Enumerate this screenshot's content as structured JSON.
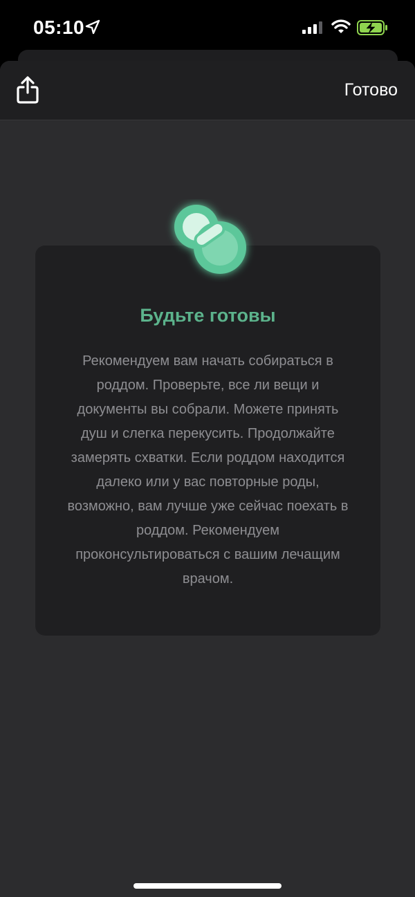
{
  "status_bar": {
    "time": "05:10",
    "icons": [
      "location-arrow-icon",
      "cellular-signal-icon",
      "wifi-icon",
      "battery-charging-icon"
    ]
  },
  "nav": {
    "share_icon": "share-icon",
    "done_label": "Готово"
  },
  "card": {
    "icon": "pacifier-icon",
    "title": "Будьте готовы",
    "body": "Рекомендуем вам начать собираться в роддом. Проверьте, все ли вещи и документы вы собрали. Можете принять душ и слегка перекусить. Продолжайте замерять схватки. Если роддом находится далеко или у вас повторные роды, возможно, вам лучше уже сейчас поехать в роддом. Рекомендуем проконсультироваться с вашим лечащим врачом."
  },
  "colors": {
    "accent": "#5cb38c",
    "background": "#2c2c2e",
    "card": "#1f1f21",
    "body_text": "#8e8e92"
  }
}
